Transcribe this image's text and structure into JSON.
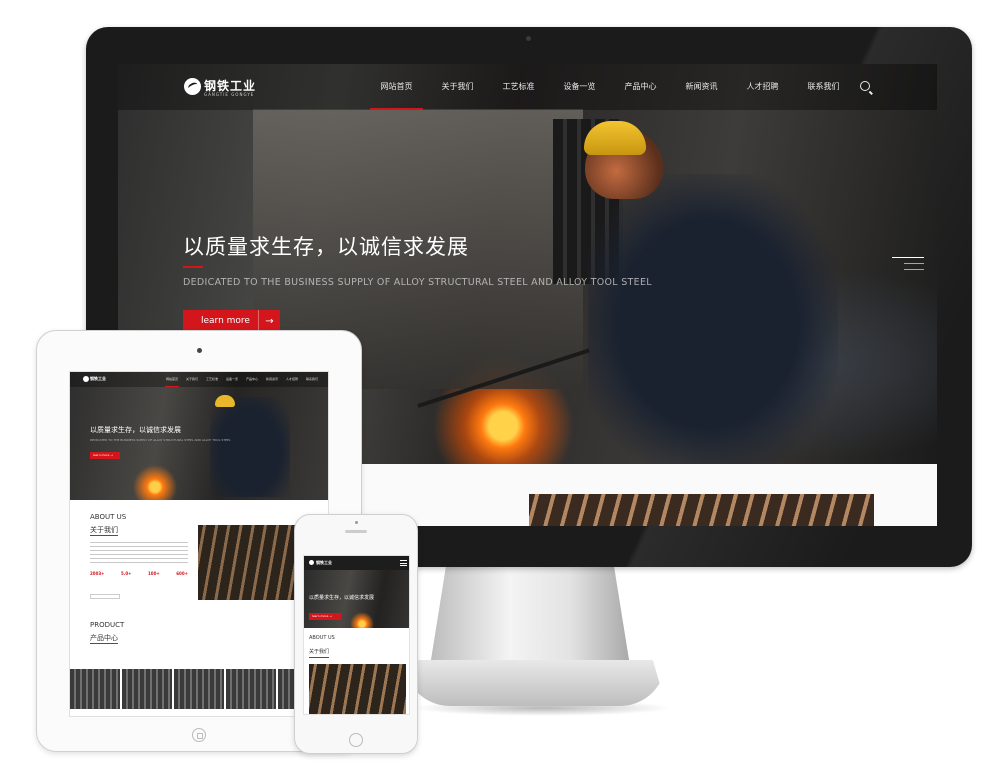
{
  "desktop": {
    "logo": {
      "text": "钢铁工业",
      "sub": "GANGTIE GONGYE"
    },
    "nav": [
      {
        "label": "网站首页",
        "active": true
      },
      {
        "label": "关于我们",
        "active": false
      },
      {
        "label": "工艺标准",
        "active": false
      },
      {
        "label": "设备一览",
        "active": false
      },
      {
        "label": "产品中心",
        "active": false
      },
      {
        "label": "新闻资讯",
        "active": false
      },
      {
        "label": "人才招聘",
        "active": false
      },
      {
        "label": "联系我们",
        "active": false
      }
    ],
    "hero": {
      "title": "以质量求生存，以诚信求发展",
      "subtitle": "DEDICATED TO THE BUSINESS SUPPLY OF ALLOY STRUCTURAL STEEL AND ALLOY TOOL STEEL",
      "button": "learn more",
      "button_arrow": "→"
    }
  },
  "tablet": {
    "logo": "钢铁工业",
    "nav": [
      "网站首页",
      "关于我们",
      "工艺标准",
      "设备一览",
      "产品中心",
      "新闻资讯",
      "人才招聘",
      "联系我们"
    ],
    "hero": {
      "title": "以质量求生存，以诚信求发展",
      "subtitle": "DEDICATED TO THE BUSINESS SUPPLY OF ALLOY STRUCTURAL STEEL AND ALLOY TOOL STEEL",
      "button": "learn more →"
    },
    "about": {
      "title_en": "ABOUT US",
      "title_zh": "关于我们",
      "stats": [
        "2003+",
        "5.0+",
        "100+",
        "600+"
      ]
    },
    "product": {
      "title_en": "PRODUCT",
      "title_zh": "产品中心"
    }
  },
  "phone": {
    "logo": "钢铁工业",
    "hero": {
      "title": "以质量求生存，以诚信求发展",
      "button": "learn more →"
    },
    "about": {
      "title_en": "ABOUT US",
      "title_zh": "关于我们"
    }
  },
  "colors": {
    "accent": "#d3151c",
    "bezel": "#1b1b1b",
    "nav_text": "#e9e9e9"
  },
  "icons": [
    "search-icon",
    "menu-icon",
    "arrow-right-icon",
    "camera-icon",
    "home-button-icon"
  ]
}
